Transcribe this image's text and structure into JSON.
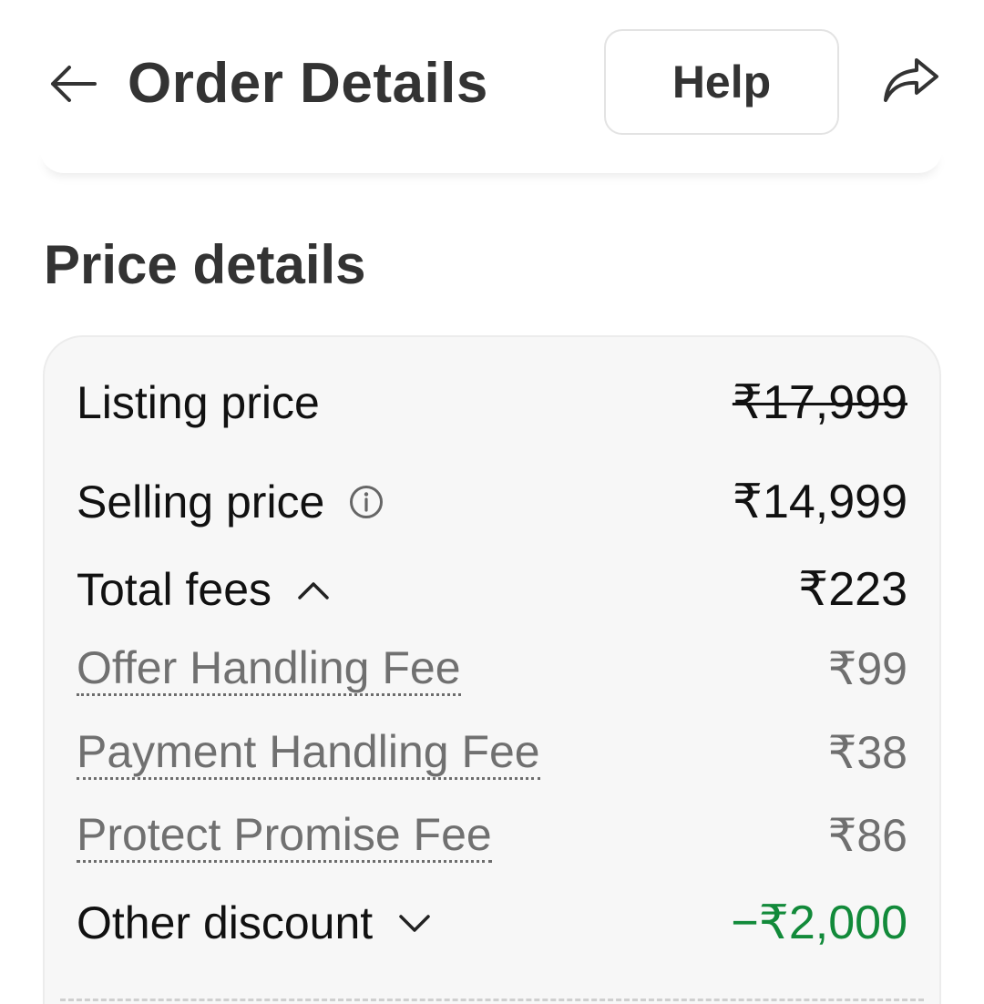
{
  "header": {
    "title": "Order Details",
    "help_label": "Help",
    "back_icon": "arrow-left-icon",
    "share_icon": "share-arrow-icon"
  },
  "price_details": {
    "title": "Price details",
    "listing_price": {
      "label": "Listing price",
      "value": "₹17,999",
      "struck": true
    },
    "selling_price": {
      "label": "Selling price",
      "value": "₹14,999",
      "info_icon": "info-icon"
    },
    "total_fees": {
      "label": "Total fees",
      "value": "₹223",
      "expanded": true,
      "toggle_icon": "chevron-up-icon",
      "items": [
        {
          "label": "Offer Handling Fee",
          "value": "₹99"
        },
        {
          "label": "Payment Handling Fee",
          "value": "₹38"
        },
        {
          "label": "Protect Promise Fee",
          "value": "₹86"
        }
      ]
    },
    "other_discount": {
      "label": "Other discount",
      "value": "−₹2,000",
      "expanded": false,
      "toggle_icon": "chevron-down-icon"
    }
  },
  "colors": {
    "discount_green": "#128a3a",
    "muted_text": "#707070",
    "card_background": "#f7f7f7"
  }
}
